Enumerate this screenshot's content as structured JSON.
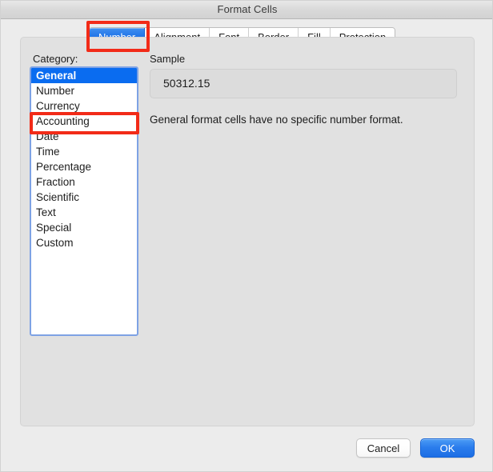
{
  "window": {
    "title": "Format Cells"
  },
  "tabs": [
    {
      "label": "Number",
      "selected": true
    },
    {
      "label": "Alignment",
      "selected": false
    },
    {
      "label": "Font",
      "selected": false
    },
    {
      "label": "Border",
      "selected": false
    },
    {
      "label": "Fill",
      "selected": false
    },
    {
      "label": "Protection",
      "selected": false
    }
  ],
  "category": {
    "label": "Category:",
    "items": [
      {
        "label": "General",
        "selected": true
      },
      {
        "label": "Number",
        "selected": false
      },
      {
        "label": "Currency",
        "selected": false
      },
      {
        "label": "Accounting",
        "selected": false
      },
      {
        "label": "Date",
        "selected": false
      },
      {
        "label": "Time",
        "selected": false
      },
      {
        "label": "Percentage",
        "selected": false
      },
      {
        "label": "Fraction",
        "selected": false
      },
      {
        "label": "Scientific",
        "selected": false
      },
      {
        "label": "Text",
        "selected": false
      },
      {
        "label": "Special",
        "selected": false
      },
      {
        "label": "Custom",
        "selected": false
      }
    ]
  },
  "sample": {
    "label": "Sample",
    "value": "50312.15"
  },
  "description": "General format cells have no specific number format.",
  "footer": {
    "cancel_label": "Cancel",
    "ok_label": "OK"
  },
  "annotations": [
    {
      "name": "number-tab-highlight",
      "color": "#f22b18"
    },
    {
      "name": "accounting-highlight",
      "color": "#f22b18"
    }
  ],
  "colors": {
    "accent_blue": "#0a6cf0",
    "annotation_red": "#f22b18",
    "window_background": "#ececec",
    "panel_background": "#e1e1e1"
  }
}
